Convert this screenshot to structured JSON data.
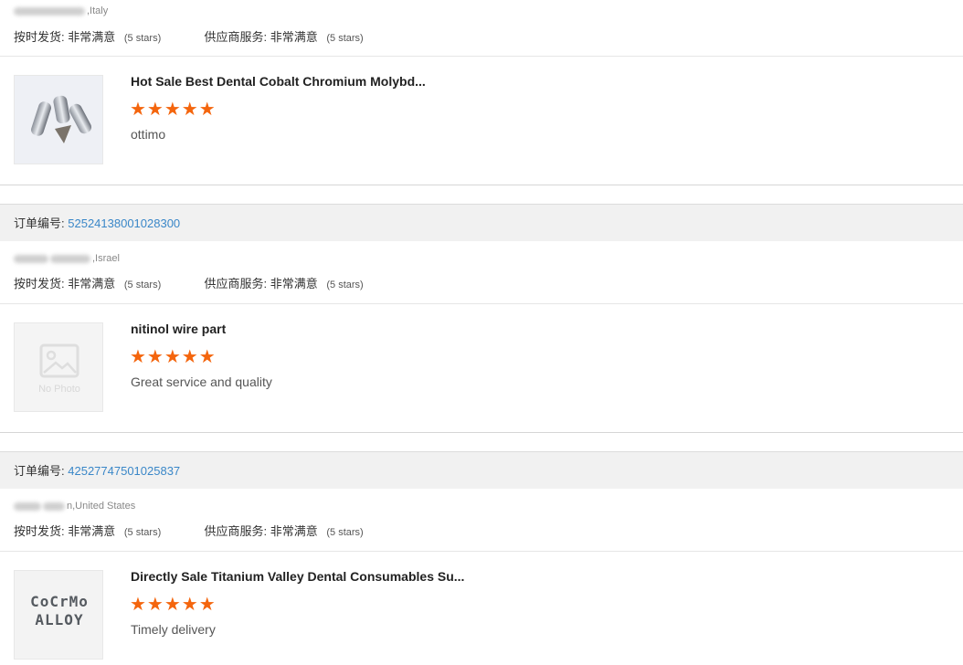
{
  "reviews": [
    {
      "order_label": "",
      "order_number": "",
      "location": ",Italy",
      "shipping_label": "按时发货:",
      "shipping_value": "非常满意",
      "shipping_stars": "(5 stars)",
      "service_label": "供应商服务:",
      "service_value": "非常满意",
      "service_stars": "(5 stars)",
      "product_title": "Hot Sale Best Dental Cobalt Chromium Molybd...",
      "rating": 5,
      "stars": "★★★★★",
      "comment": "ottimo"
    },
    {
      "order_label": "订单编号:",
      "order_number": "52524138001028300",
      "location": ",Israel",
      "shipping_label": "按时发货:",
      "shipping_value": "非常满意",
      "shipping_stars": "(5 stars)",
      "service_label": "供应商服务:",
      "service_value": "非常满意",
      "service_stars": "(5 stars)",
      "product_title": "nitinol wire part",
      "thumb_text": "No Photo",
      "rating": 5,
      "stars": "★★★★★",
      "comment": "Great service and quality"
    },
    {
      "order_label": "订单编号:",
      "order_number": "42527747501025837",
      "location": "n,United States",
      "shipping_label": "按时发货:",
      "shipping_value": "非常满意",
      "shipping_stars": "(5 stars)",
      "service_label": "供应商服务:",
      "service_value": "非常满意",
      "service_stars": "(5 stars)",
      "product_title": "Directly Sale Titanium Valley Dental Consumables Su...",
      "thumb_text": "CoCrMo ALLOY",
      "rating": 5,
      "stars": "★★★★★",
      "comment": "Timely delivery"
    }
  ],
  "colors": {
    "star": "#f4650d",
    "order_number": "#3a87c8",
    "header_bg": "#f1f1f1"
  }
}
